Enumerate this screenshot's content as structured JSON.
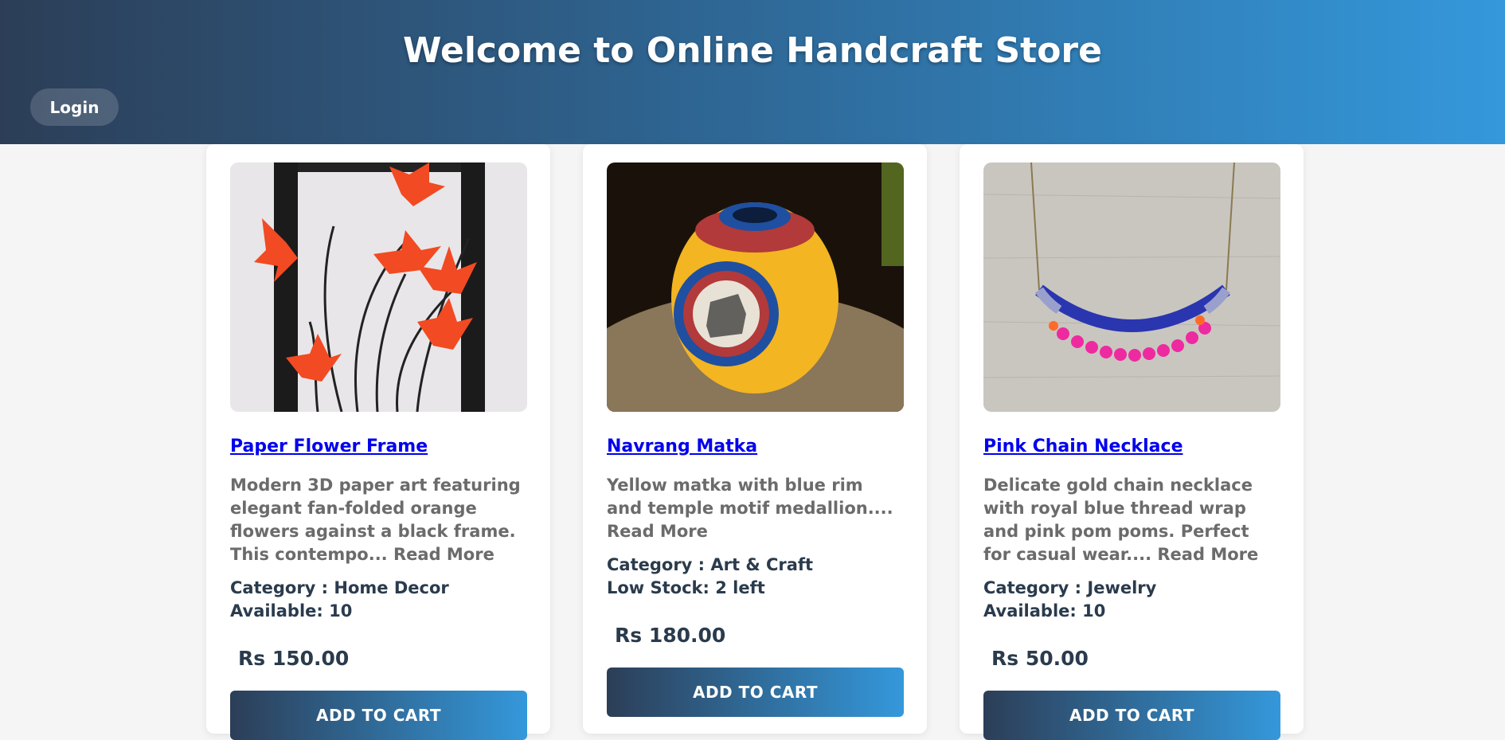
{
  "header": {
    "title": "Welcome to Online Handcraft Store",
    "login_label": "Login"
  },
  "products": [
    {
      "name": "Paper Flower Frame",
      "description": "Modern 3D paper art featuring elegant fan-folded orange flowers against a black frame. This contempo...",
      "read_more": "Read More",
      "category": "Category : Home Decor",
      "stock": "Available: 10",
      "price": "Rs 150.00",
      "cart_label": "ADD TO CART"
    },
    {
      "name": "Navrang Matka",
      "description": "Yellow matka with blue rim and temple motif medallion....",
      "read_more": "Read More",
      "category": "Category : Art & Craft",
      "stock": "Low Stock: 2 left",
      "price": "Rs 180.00",
      "cart_label": "ADD TO CART"
    },
    {
      "name": "Pink Chain Necklace",
      "description": "Delicate gold chain necklace with royal blue thread wrap and pink pom poms. Perfect for casual wear....",
      "read_more": "Read More",
      "category": "Category : Jewelry",
      "stock": "Available: 10",
      "price": "Rs 50.00",
      "cart_label": "ADD TO CART"
    }
  ],
  "colors": {
    "header_start": "#2c3e57",
    "header_end": "#3498db",
    "link": "#0000ee",
    "text_dark": "#2a3b4d",
    "text_muted": "#6b6b6b"
  }
}
